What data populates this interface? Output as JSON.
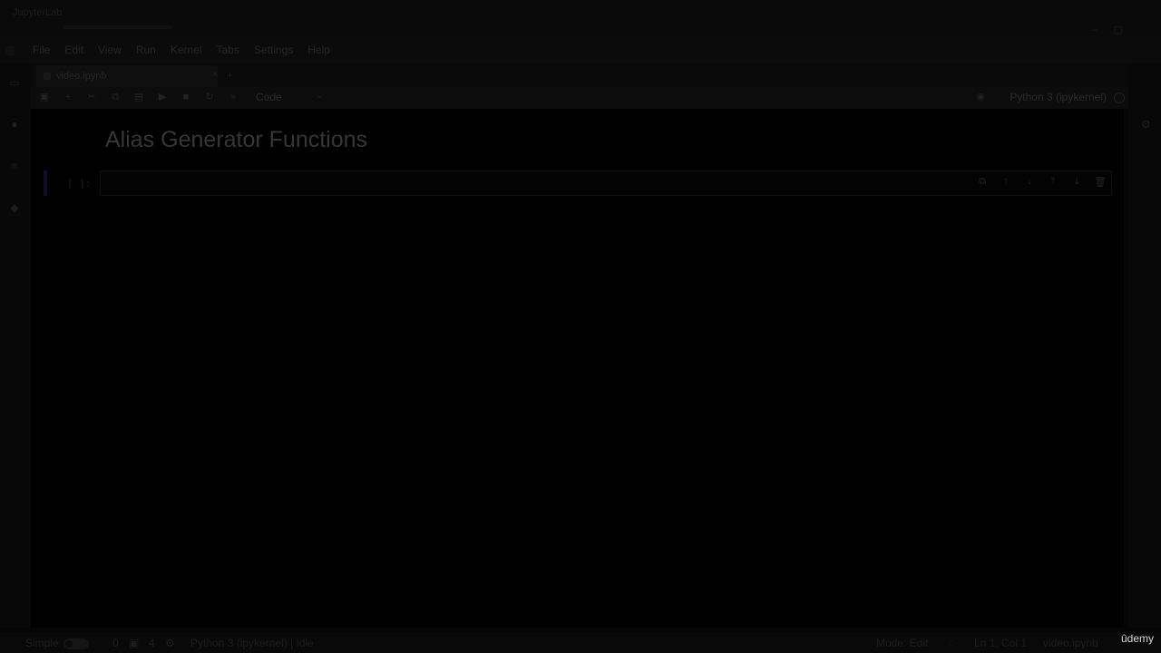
{
  "window": {
    "title": "JupyterLab"
  },
  "menu": [
    "File",
    "Edit",
    "View",
    "Run",
    "Kernel",
    "Tabs",
    "Settings",
    "Help"
  ],
  "tab": {
    "name": "video.ipynb",
    "close": "×"
  },
  "toolbar": {
    "cell_type": "Code",
    "kernel": "Python 3 (ipykernel)"
  },
  "notebook": {
    "heading": "Alias Generator Functions",
    "prompt": "[ ]:"
  },
  "status": {
    "mode_label": "Simple",
    "counts": [
      "0",
      "4"
    ],
    "kernel_status": "Python 3 (ipykernel) | Idle",
    "mode": "Mode: Edit",
    "position": "Ln 1, Col 1",
    "file": "video.ipynb"
  },
  "watermark": "ûdemy"
}
